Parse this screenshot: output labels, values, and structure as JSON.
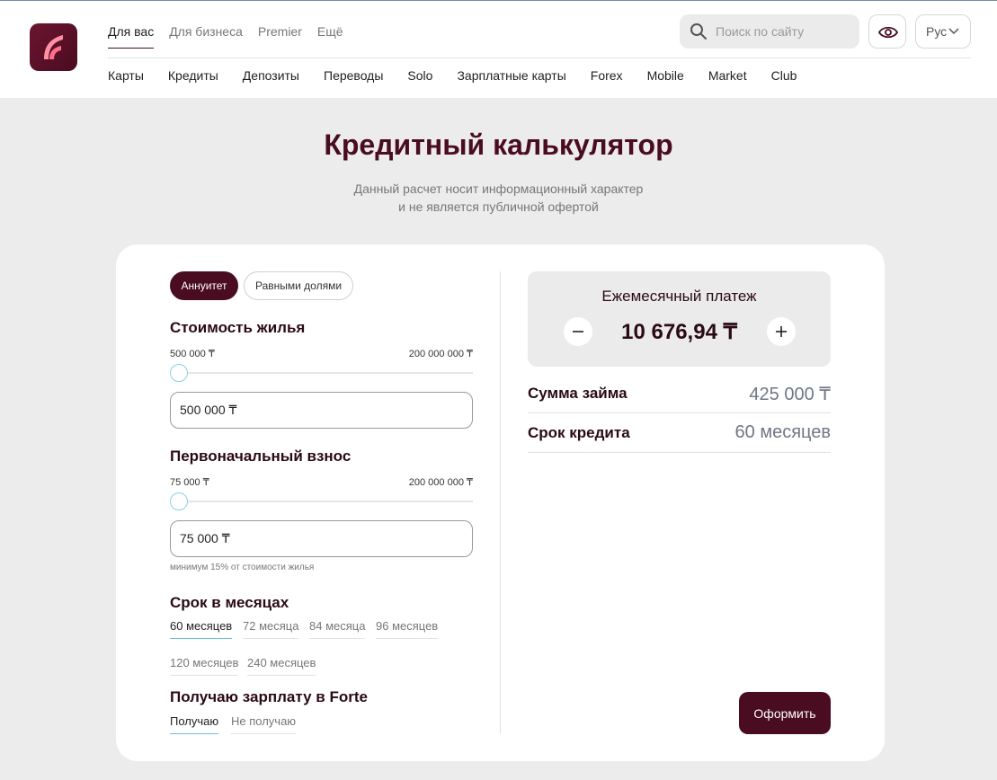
{
  "header": {
    "segments": [
      {
        "label": "Для вас"
      },
      {
        "label": "Для бизнеса"
      },
      {
        "label": "Premier"
      },
      {
        "label": "Ещё"
      }
    ],
    "search": {
      "placeholder": "Поиск по сайту"
    },
    "language": "Рус",
    "categories": [
      {
        "label": "Карты"
      },
      {
        "label": "Кредиты"
      },
      {
        "label": "Депозиты"
      },
      {
        "label": "Переводы"
      },
      {
        "label": "Solo"
      },
      {
        "label": "Зарплатные карты"
      },
      {
        "label": "Forex"
      },
      {
        "label": "Mobile"
      },
      {
        "label": "Market"
      },
      {
        "label": "Club"
      }
    ],
    "brand_color": "#4a0c20"
  },
  "hero": {
    "title": "Кредитный калькулятор",
    "subtitle_line1": "Данный расчет носит информационный характер",
    "subtitle_line2": "и не является публичной офертой"
  },
  "calculator": {
    "modes": [
      {
        "label": "Аннуитет",
        "selected": true
      },
      {
        "label": "Равными долями",
        "selected": false
      }
    ],
    "price": {
      "title": "Стоимость жилья",
      "min_label": "500 000 ₸",
      "max_label": "200 000 000 ₸",
      "value": "500 000 ₸",
      "slider_fraction": 0
    },
    "down_payment": {
      "title": "Первоначальный взнос",
      "min_label": "75 000 ₸",
      "max_label": "200 000 000 ₸",
      "value": "75 000 ₸",
      "slider_fraction": 0,
      "hint": "минимум 15% от стоимости жилья"
    },
    "term": {
      "title": "Срок в месяцах",
      "options": [
        "60 месяцев",
        "72 месяца",
        "84 месяца",
        "96 месяцев",
        "120 месяцев",
        "240 месяцев"
      ],
      "selected": "60 месяцев"
    },
    "salary": {
      "title": "Получаю зарплату в Forte",
      "options": [
        "Получаю",
        "Не получаю"
      ],
      "selected": "Получаю"
    }
  },
  "result": {
    "monthly_title": "Ежемесячный платеж",
    "monthly_value": "10 676,94 ₸",
    "loan_label": "Сумма займа",
    "loan_value": "425 000 ₸",
    "term_label": "Срок кредита",
    "term_value": "60 месяцев",
    "submit_label": "Оформить"
  }
}
